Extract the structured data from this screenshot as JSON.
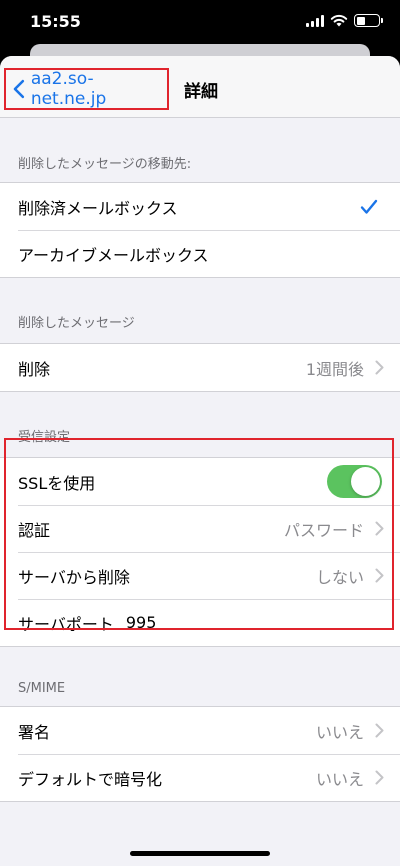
{
  "status_bar": {
    "time": "15:55"
  },
  "nav": {
    "back_label": "aa2.so-net.ne.jp",
    "title": "詳細"
  },
  "sections": {
    "move_to": {
      "header": "削除したメッセージの移動先:",
      "items": [
        {
          "label": "削除済メールボックス",
          "checked": true
        },
        {
          "label": "アーカイブメールボックス",
          "checked": false
        }
      ]
    },
    "deleted": {
      "header": "削除したメッセージ",
      "items": [
        {
          "label": "削除",
          "value": "1週間後"
        }
      ]
    },
    "incoming": {
      "header": "受信設定",
      "ssl": {
        "label": "SSLを使用",
        "on": true
      },
      "auth": {
        "label": "認証",
        "value": "パスワード"
      },
      "delete_from_server": {
        "label": "サーバから削除",
        "value": "しない"
      },
      "port": {
        "label": "サーバポート",
        "value": "995"
      }
    },
    "smime": {
      "header": "S/MIME",
      "sign": {
        "label": "署名",
        "value": "いいえ"
      },
      "encrypt": {
        "label": "デフォルトで暗号化",
        "value": "いいえ"
      }
    }
  },
  "colors": {
    "accent": "#1a74e8",
    "toggle_on": "#5bc35f",
    "highlight": "#e0242d"
  }
}
